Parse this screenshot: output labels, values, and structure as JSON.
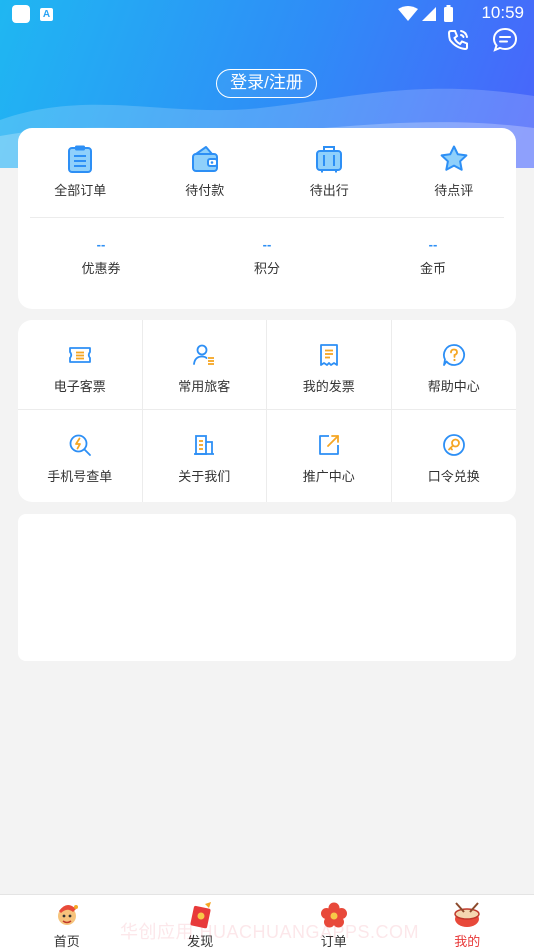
{
  "status_bar": {
    "time": "10:59",
    "app_badge": "A"
  },
  "header": {
    "login_label": "登录/注册"
  },
  "orders": [
    {
      "label": "全部订单",
      "icon": "clipboard-icon"
    },
    {
      "label": "待付款",
      "icon": "wallet-icon"
    },
    {
      "label": "待出行",
      "icon": "luggage-icon"
    },
    {
      "label": "待点评",
      "icon": "star-icon"
    }
  ],
  "stats": [
    {
      "value": "--",
      "label": "优惠券"
    },
    {
      "value": "--",
      "label": "积分"
    },
    {
      "value": "--",
      "label": "金币"
    }
  ],
  "services": [
    {
      "label": "电子客票",
      "icon": "ticket-icon"
    },
    {
      "label": "常用旅客",
      "icon": "passenger-icon"
    },
    {
      "label": "我的发票",
      "icon": "invoice-icon"
    },
    {
      "label": "帮助中心",
      "icon": "help-icon"
    },
    {
      "label": "手机号查单",
      "icon": "phone-search-icon"
    },
    {
      "label": "关于我们",
      "icon": "building-icon"
    },
    {
      "label": "推广中心",
      "icon": "share-icon"
    },
    {
      "label": "口令兑换",
      "icon": "redeem-icon"
    }
  ],
  "tabbar": [
    {
      "label": "首页",
      "active": false
    },
    {
      "label": "发现",
      "active": false
    },
    {
      "label": "订单",
      "active": false
    },
    {
      "label": "我的",
      "active": true
    }
  ],
  "watermark": "华创应用 HUACHUANGAPPS.COM",
  "colors": {
    "accent": "#2d8ff5",
    "active_tab": "#e83a3a",
    "header_start": "#1fb7f2",
    "header_end": "#4a63fb",
    "icon_orange": "#f5a623"
  }
}
